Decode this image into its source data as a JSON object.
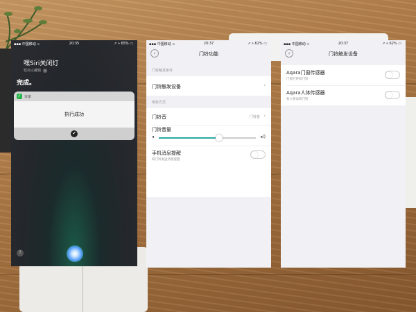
{
  "phone1": {
    "status": {
      "carrier": "▪▪▪ 中国移动 ≈",
      "time": "20:35",
      "battery": "↗ ⋄ 65% ▭"
    },
    "query": "嘿Siri关闭灯",
    "edit_hint": "轻点以编辑",
    "done": "完成。",
    "card": {
      "app_name": "米家",
      "message": "执行成功"
    },
    "icons": {
      "help": "?",
      "check": "✔",
      "app": "✓"
    }
  },
  "phone2": {
    "status": {
      "carrier": "▪▪▪ 中国移动 ≈",
      "time": "20:37",
      "battery": "↗ ⋄ 62% ▭"
    },
    "title": "门铃功能",
    "section_trigger": "门铃触发条件",
    "trigger_device": "门铃触发设备",
    "section_ring": "响铃方式",
    "ringtone_label": "门铃音",
    "ringtone_value": "门铃音",
    "volume_label": "门铃音量",
    "volume_level": 0.62,
    "notify_label": "手机消息提醒",
    "notify_sub": "响门铃发送消息提醒",
    "notify_on": false
  },
  "phone3": {
    "status": {
      "carrier": "▪▪▪ 中国移动 ≈",
      "time": "20:37",
      "battery": "↗ ⋄ 62% ▭"
    },
    "title": "门铃触发设备",
    "devices": [
      {
        "name": "Aqara门窗传感器",
        "desc": "门窗打开响门铃",
        "on": false
      },
      {
        "name": "Aqara人体传感器",
        "desc": "有人移动响门铃",
        "on": false
      }
    ]
  },
  "colors": {
    "accent": "#2aa8a0",
    "siri_glow": "#1b5a46",
    "app_green": "#28b34a"
  }
}
